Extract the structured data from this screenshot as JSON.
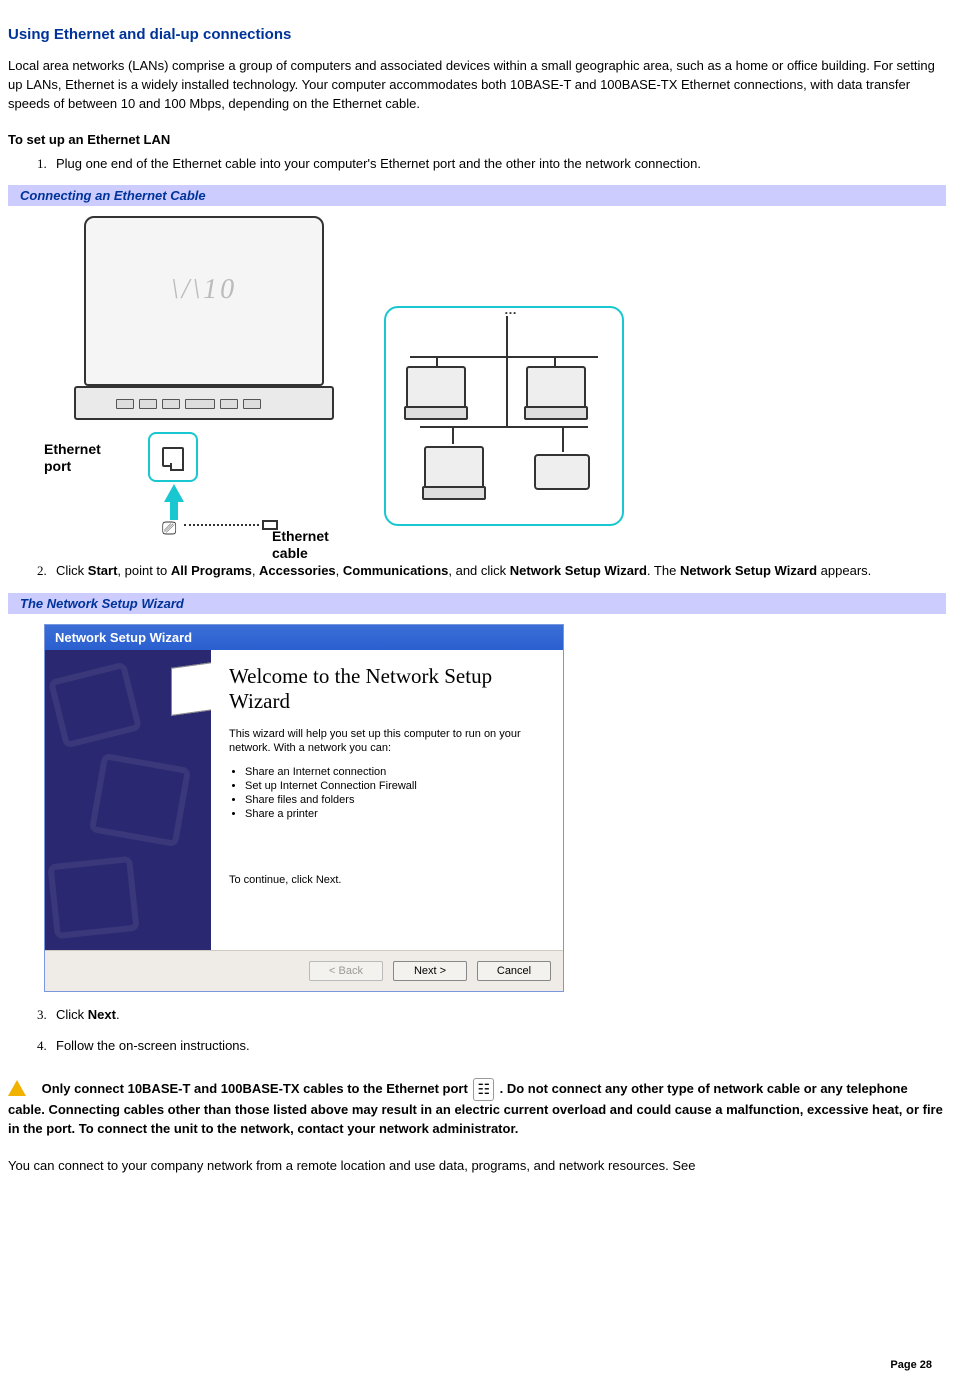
{
  "heading": "Using Ethernet and dial-up connections",
  "intro": "Local area networks (LANs) comprise a group of computers and associated devices within a small geographic area, such as a home or office building. For setting up LANs, Ethernet is a widely installed technology. Your computer accommodates both 10BASE-T and 100BASE-TX Ethernet connections, with data transfer speeds of between 10 and 100 Mbps, depending on the Ethernet cable.",
  "setup_heading": "To set up an Ethernet LAN",
  "steps": [
    {
      "text_before": "Plug one end of the Ethernet cable into your computer's Ethernet port and the other into the network connection."
    },
    {
      "text_before": "Click ",
      "b1": "Start",
      "m1": ", point to ",
      "b2": "All Programs",
      "m2": ", ",
      "b3": "Accessories",
      "m3": ", ",
      "b4": "Communications",
      "m4": ", and click ",
      "b5": "Network Setup Wizard",
      "m5": ". The ",
      "b6": "Network Setup Wizard",
      "m6": " appears."
    },
    {
      "text_before": "Click ",
      "b1": "Next",
      "m1": "."
    },
    {
      "text_before": "Follow the on-screen instructions."
    }
  ],
  "caption1": "Connecting an Ethernet Cable",
  "fig1": {
    "laptop_logo": "\\/\\10",
    "ethernet_port_label": "Ethernet\nport",
    "ethernet_cable_label": "Ethernet\ncable"
  },
  "caption2": "The Network Setup Wizard",
  "wizard": {
    "title": "Network Setup Wizard",
    "heading": "Welcome to the Network Setup Wizard",
    "intro": "This wizard will help you set up this computer to run on your network. With a network you can:",
    "bullets": [
      "Share an Internet connection",
      "Set up Internet Connection Firewall",
      "Share files and folders",
      "Share a printer"
    ],
    "continue": "To continue, click Next.",
    "back": "< Back",
    "next": "Next >",
    "cancel": "Cancel"
  },
  "warning": {
    "t1": "Only connect 10BASE-T and 100BASE-TX cables to the Ethernet port ",
    "glyph": "⎇",
    "t2": " . Do not connect any other type of network cable or any telephone cable. Connecting cables other than those listed above may result in an electric current overload and could cause a malfunction, excessive heat, or fire in the port. To connect the unit to the network, contact your network administrator."
  },
  "footer_text": "You can connect to your company network from a remote location and use data, programs, and network resources. See",
  "page_number": "Page 28"
}
